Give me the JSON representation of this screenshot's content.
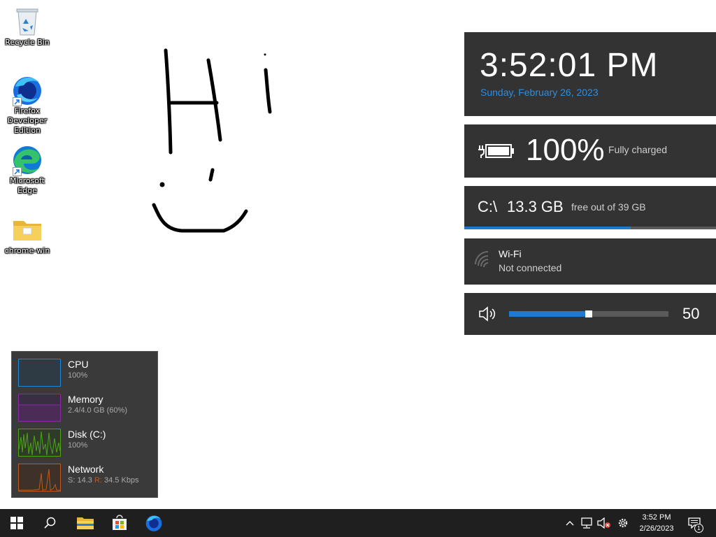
{
  "desktop": {
    "icons": [
      {
        "label": "Recycle Bin",
        "icon": "recycle-bin-icon"
      },
      {
        "label": "Firefox Developer Edition",
        "icon": "firefox-dev-icon"
      },
      {
        "label": "Microsoft Edge",
        "icon": "edge-icon"
      },
      {
        "label": "chrome-win",
        "icon": "folder-icon"
      }
    ],
    "drawing_text": "Hi"
  },
  "widgets": {
    "clock": {
      "time": "3:52:01 PM",
      "date": "Sunday, February 26, 2023",
      "date_color": "#2d8ee0"
    },
    "battery": {
      "percent": "100%",
      "state": "Fully charged"
    },
    "disk": {
      "drive": "C:\\",
      "free": "13.3 GB",
      "of": "free out of 39 GB",
      "used_fraction": 0.66
    },
    "wifi": {
      "name": "Wi-Fi",
      "status": "Not connected"
    },
    "volume": {
      "value": "50",
      "level": 0.5
    }
  },
  "perf_monitor": {
    "rows": [
      {
        "name": "CPU",
        "value": "100%",
        "color": "#1c8ad6"
      },
      {
        "name": "Memory",
        "value": "2.4/4.0 GB (60%)",
        "color": "#8b2aa6"
      },
      {
        "name": "Disk (C:)",
        "value": "100%",
        "color": "#4da515"
      },
      {
        "name": "Network",
        "value_send_label": "S:",
        "value_send": "14.3",
        "value_recv_label": "R:",
        "value_recv": "34.5 Kbps",
        "color": "#c0591d"
      }
    ]
  },
  "taskbar": {
    "buttons": [
      "start-icon",
      "search-icon",
      "file-explorer-icon",
      "microsoft-store-icon",
      "firefox-dev-icon"
    ],
    "tray_time": "3:52 PM",
    "tray_date": "2/26/2023",
    "notification_count": "1"
  },
  "colors": {
    "widget_bg": "#333333",
    "accent": "#1e79d0",
    "taskbar_bg": "#1f1f1f"
  }
}
